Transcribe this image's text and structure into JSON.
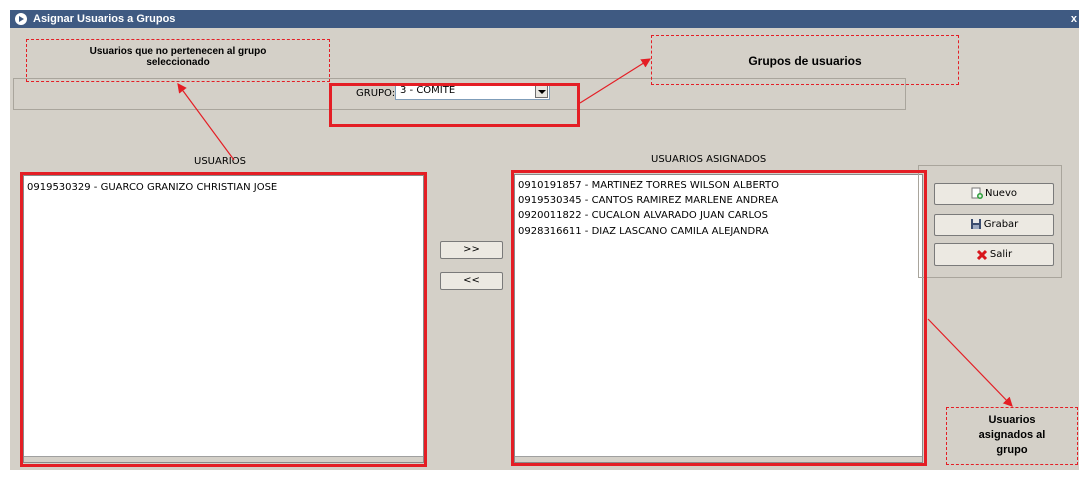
{
  "window": {
    "title": "Asignar Usuarios a Grupos",
    "close": "x"
  },
  "grupo": {
    "label": "GRUPO:",
    "selected": "3 - COMITE"
  },
  "lists": {
    "usuarios_header": "USUARIOS",
    "asignados_header": "USUARIOS ASIGNADOS",
    "usuarios": [
      "0919530329 - GUARCO GRANIZO CHRISTIAN JOSE"
    ],
    "asignados": [
      "0910191857 - MARTINEZ TORRES WILSON ALBERTO",
      "0919530345 - CANTOS RAMIREZ MARLENE ANDREA",
      "0920011822 - CUCALON ALVARADO JUAN CARLOS",
      "0928316611 - DIAZ LASCANO CAMILA ALEJANDRA"
    ]
  },
  "buttons": {
    "add": ">>",
    "remove": "<<",
    "nuevo": "Nuevo",
    "grabar": "Grabar",
    "salir": "Salir"
  },
  "annotations": {
    "no_pertenecen_line1": "Usuarios que no pertenecen al grupo",
    "no_pertenecen_line2": "seleccionado",
    "grupos": "Grupos de usuarios",
    "asignados_line1": "Usuarios",
    "asignados_line2": "asignados al",
    "asignados_line3": "grupo"
  },
  "colors": {
    "annotation_red": "#e41e25",
    "titlebar": "#3f5a82",
    "window_bg": "#d4d0c8"
  }
}
